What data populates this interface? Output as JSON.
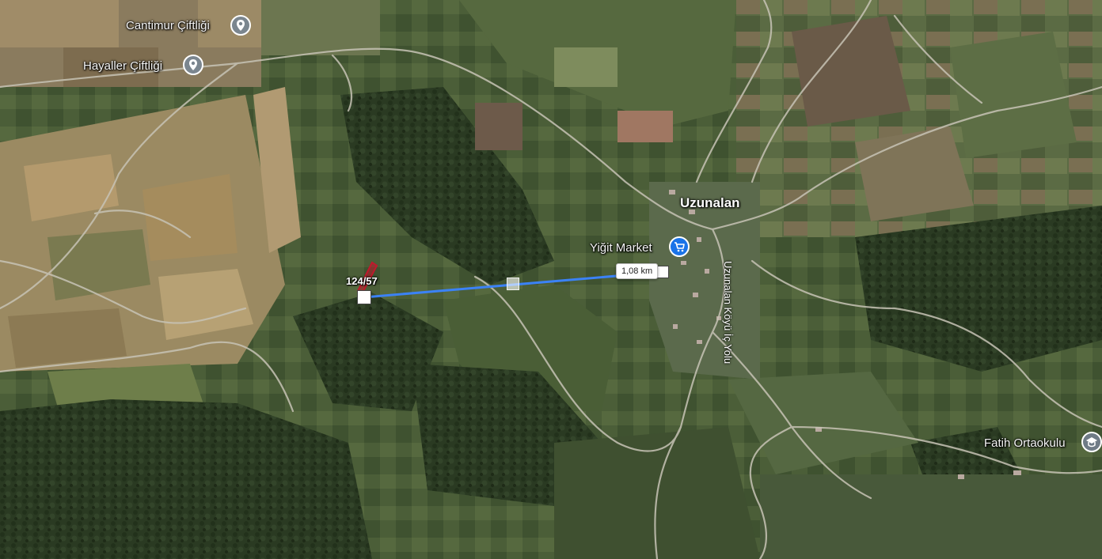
{
  "map": {
    "type": "satellite",
    "colors": {
      "measure_line": "#3b82f6",
      "parcel": "#c0182c",
      "poi_grey": "#7b868f",
      "poi_blue": "#1a73e8"
    }
  },
  "pois": {
    "cantimur": {
      "label": "Cantimur Çiftliği",
      "icon": "pin-icon"
    },
    "hayaller": {
      "label": "Hayaller Çiftliği",
      "icon": "pin-icon"
    },
    "yigit": {
      "label": "Yiğit Market",
      "icon": "shopping-cart-icon"
    },
    "fatih": {
      "label": "Fatih Ortaokulu",
      "icon": "school-icon"
    }
  },
  "places": {
    "village": "Uzunalan"
  },
  "roads": {
    "koy_ic_yolu": "Uzunalan Köyü İç Yolu"
  },
  "parcel": {
    "label": "124/57"
  },
  "measurement": {
    "distance": "1,08 km"
  }
}
